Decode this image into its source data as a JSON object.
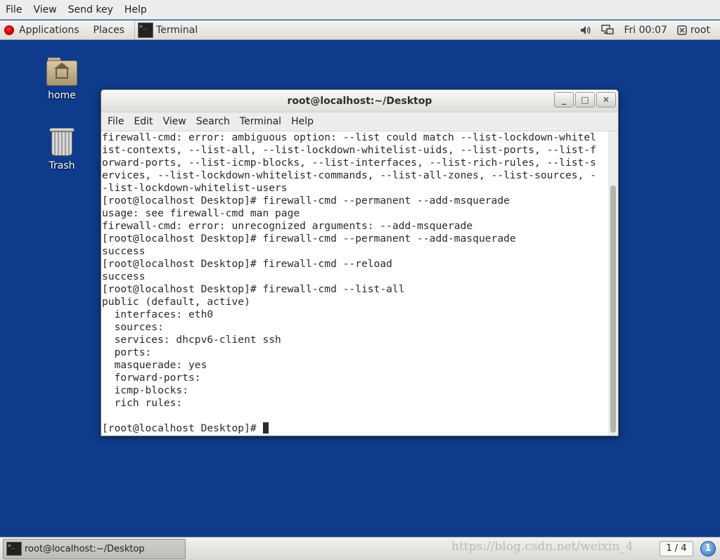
{
  "vm_menu": {
    "file": "File",
    "view": "View",
    "send_key": "Send key",
    "help": "Help"
  },
  "top_panel": {
    "applications": "Applications",
    "places": "Places",
    "terminal": "Terminal",
    "clock": "Fri 00:07",
    "user": "root",
    "icons": {
      "volume": "speaker-icon",
      "network": "network-icon",
      "power": "power-icon"
    }
  },
  "desktop": {
    "home_label": "home",
    "trash_label": "Trash"
  },
  "window": {
    "title": "root@localhost:~/Desktop",
    "controls": {
      "minimize": "_",
      "maximize": "□",
      "close": "✕"
    },
    "menu": {
      "file": "File",
      "edit": "Edit",
      "view": "View",
      "search": "Search",
      "terminal": "Terminal",
      "help": "Help"
    }
  },
  "terminal": {
    "lines": [
      "firewall-cmd: error: ambiguous option: --list could match --list-lockdown-whitel",
      "ist-contexts, --list-all, --list-lockdown-whitelist-uids, --list-ports, --list-f",
      "orward-ports, --list-icmp-blocks, --list-interfaces, --list-rich-rules, --list-s",
      "ervices, --list-lockdown-whitelist-commands, --list-all-zones, --list-sources, -",
      "-list-lockdown-whitelist-users",
      "[root@localhost Desktop]# firewall-cmd --permanent --add-msquerade",
      "usage: see firewall-cmd man page",
      "firewall-cmd: error: unrecognized arguments: --add-msquerade",
      "[root@localhost Desktop]# firewall-cmd --permanent --add-masquerade",
      "success",
      "[root@localhost Desktop]# firewall-cmd --reload",
      "success",
      "[root@localhost Desktop]# firewall-cmd --list-all",
      "public (default, active)",
      "  interfaces: eth0",
      "  sources: ",
      "  services: dhcpv6-client ssh",
      "  ports: ",
      "  masquerade: yes",
      "  forward-ports: ",
      "  icmp-blocks: ",
      "  rich rules: ",
      "",
      "[root@localhost Desktop]# "
    ]
  },
  "bottom_panel": {
    "task_label": "root@localhost:~/Desktop",
    "workspace": "1 / 4",
    "watermark": "https://blog.csdn.net/weixin_4",
    "notify_icon": "info-icon",
    "notify_glyph": "1"
  }
}
